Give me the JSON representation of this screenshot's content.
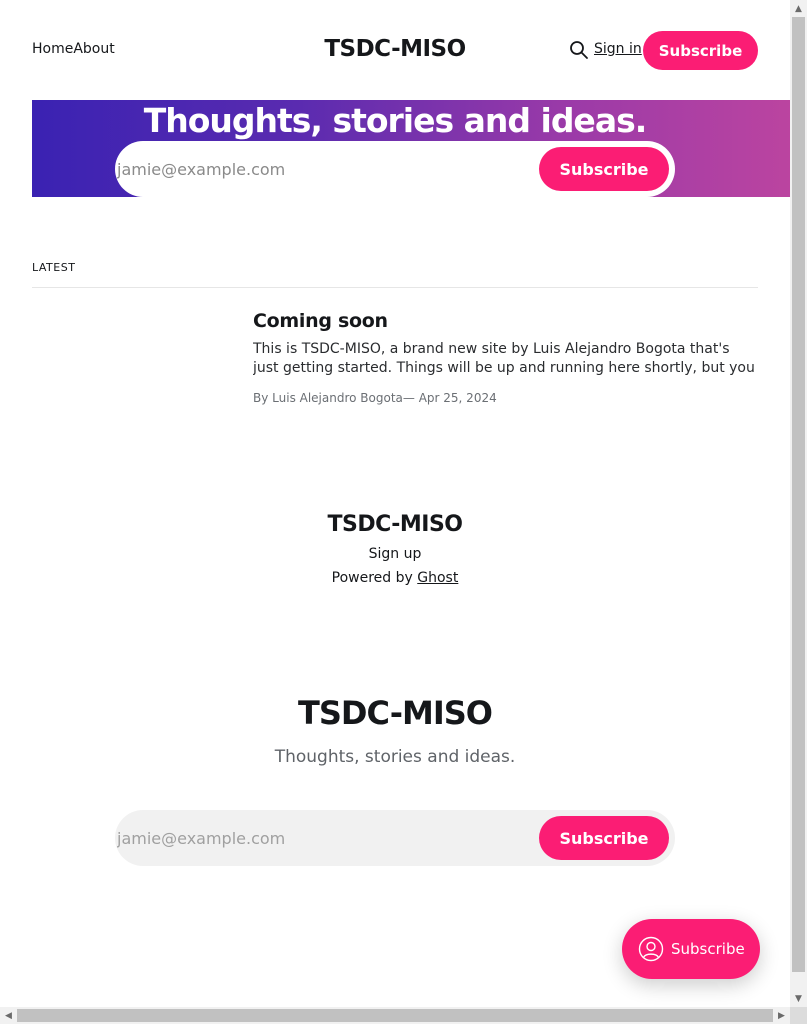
{
  "header": {
    "nav": [
      {
        "label": "Home"
      },
      {
        "label": "About"
      }
    ],
    "site_title": "TSDC-MISO",
    "search_icon": "search-icon",
    "signin_label": "Sign in",
    "subscribe_label": "Subscribe"
  },
  "hero": {
    "title": "Thoughts, stories and ideas.",
    "email_placeholder": "jamie@example.com",
    "subscribe_label": "Subscribe",
    "gradient_start": "#3a22b2",
    "gradient_end": "#bb44a0"
  },
  "latest": {
    "section_label": "LATEST",
    "posts": [
      {
        "title": "Coming soon",
        "excerpt": "This is TSDC-MISO, a brand new site by Luis Alejandro Bogota that's just getting started. Things will be up and running here shortly, but you can…",
        "author_prefix": "By Luis Alejandro Bogota",
        "date_sep": "— Apr 25, 2024"
      }
    ]
  },
  "footer": {
    "site_title": "TSDC-MISO",
    "signup_label": "Sign up",
    "powered_prefix": "Powered by ",
    "powered_link": "Ghost"
  },
  "cta": {
    "title": "TSDC-MISO",
    "subtitle": "Thoughts, stories and ideas.",
    "email_placeholder": "jamie@example.com",
    "subscribe_label": "Subscribe"
  },
  "portal": {
    "label": "Subscribe",
    "icon": "user-circle-icon"
  },
  "colors": {
    "accent": "#fb1d74",
    "text": "#15171a"
  }
}
